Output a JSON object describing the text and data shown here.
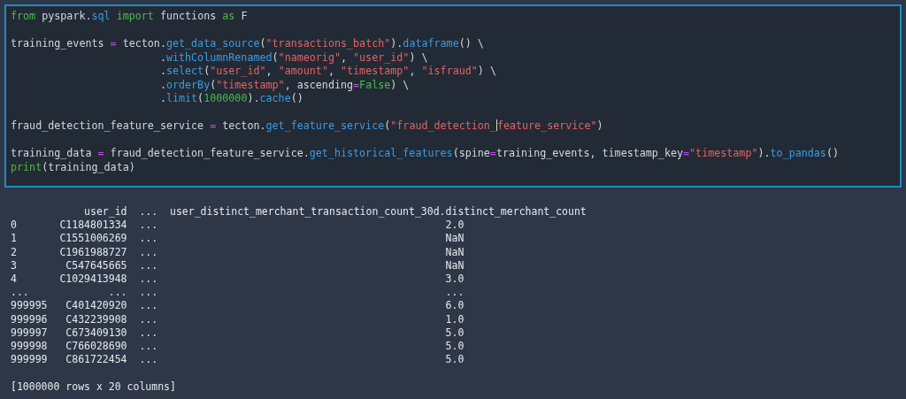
{
  "code_cell": {
    "lines": [
      {
        "kind": "code",
        "tokens": [
          {
            "kind": "kw",
            "t": "from"
          },
          {
            "kind": "p",
            "t": " pyspark."
          },
          {
            "kind": "f",
            "t": "sql"
          },
          {
            "kind": "kw",
            "t": " import"
          },
          {
            "kind": "p",
            "t": " functions "
          },
          {
            "kind": "kw",
            "t": "as"
          },
          {
            "kind": "p",
            "t": " F"
          }
        ]
      },
      {
        "kind": "blank"
      },
      {
        "kind": "code",
        "tokens": [
          {
            "kind": "p",
            "t": "training_events "
          },
          {
            "kind": "op",
            "t": "="
          },
          {
            "kind": "p",
            "t": " tecton."
          },
          {
            "kind": "f",
            "t": "get_data_source"
          },
          {
            "kind": "p",
            "t": "("
          },
          {
            "kind": "s",
            "t": "\"transactions_batch\""
          },
          {
            "kind": "p",
            "t": ")."
          },
          {
            "kind": "f",
            "t": "dataframe"
          },
          {
            "kind": "p",
            "t": "() \\"
          }
        ]
      },
      {
        "kind": "code",
        "tokens": [
          {
            "kind": "p",
            "t": "                        ."
          },
          {
            "kind": "f",
            "t": "withColumnRenamed"
          },
          {
            "kind": "p",
            "t": "("
          },
          {
            "kind": "s",
            "t": "\"nameorig\""
          },
          {
            "kind": "p",
            "t": ", "
          },
          {
            "kind": "s",
            "t": "\"user_id\""
          },
          {
            "kind": "p",
            "t": ") \\"
          }
        ]
      },
      {
        "kind": "code",
        "tokens": [
          {
            "kind": "p",
            "t": "                        ."
          },
          {
            "kind": "f",
            "t": "select"
          },
          {
            "kind": "p",
            "t": "("
          },
          {
            "kind": "s",
            "t": "\"user_id\""
          },
          {
            "kind": "p",
            "t": ", "
          },
          {
            "kind": "s",
            "t": "\"amount\""
          },
          {
            "kind": "p",
            "t": ", "
          },
          {
            "kind": "s",
            "t": "\"timestamp\""
          },
          {
            "kind": "p",
            "t": ", "
          },
          {
            "kind": "s",
            "t": "\"isfraud\""
          },
          {
            "kind": "p",
            "t": ") \\"
          }
        ]
      },
      {
        "kind": "code",
        "tokens": [
          {
            "kind": "p",
            "t": "                        ."
          },
          {
            "kind": "f",
            "t": "orderBy"
          },
          {
            "kind": "p",
            "t": "("
          },
          {
            "kind": "s",
            "t": "\"timestamp\""
          },
          {
            "kind": "p",
            "t": ", ascending"
          },
          {
            "kind": "op",
            "t": "="
          },
          {
            "kind": "kw",
            "t": "False"
          },
          {
            "kind": "p",
            "t": ") \\"
          }
        ]
      },
      {
        "kind": "code",
        "tokens": [
          {
            "kind": "p",
            "t": "                        ."
          },
          {
            "kind": "f",
            "t": "limit"
          },
          {
            "kind": "p",
            "t": "("
          },
          {
            "kind": "n",
            "t": "1000000"
          },
          {
            "kind": "p",
            "t": ")."
          },
          {
            "kind": "f",
            "t": "cache"
          },
          {
            "kind": "p",
            "t": "()"
          }
        ]
      },
      {
        "kind": "blank"
      },
      {
        "kind": "code",
        "tokens": [
          {
            "kind": "p",
            "t": "fraud_detection_feature_service "
          },
          {
            "kind": "op",
            "t": "="
          },
          {
            "kind": "p",
            "t": " tecton."
          },
          {
            "kind": "f",
            "t": "get_feature_service"
          },
          {
            "kind": "p",
            "t": "("
          },
          {
            "kind": "s",
            "t": "\"fraud_detection_",
            "cursor": true
          },
          {
            "kind": "s",
            "t": "feature_service\""
          },
          {
            "kind": "p",
            "t": ")"
          }
        ]
      },
      {
        "kind": "blank"
      },
      {
        "kind": "code",
        "tokens": [
          {
            "kind": "p",
            "t": "training_data "
          },
          {
            "kind": "op",
            "t": "="
          },
          {
            "kind": "p",
            "t": " fraud_detection_feature_service."
          },
          {
            "kind": "f",
            "t": "get_historical_features"
          },
          {
            "kind": "p",
            "t": "(spine"
          },
          {
            "kind": "op",
            "t": "="
          },
          {
            "kind": "p",
            "t": "training_events, timestamp_key"
          },
          {
            "kind": "op",
            "t": "="
          },
          {
            "kind": "s",
            "t": "\"timestamp\""
          },
          {
            "kind": "p",
            "t": ")."
          },
          {
            "kind": "f",
            "t": "to_pandas"
          },
          {
            "kind": "p",
            "t": "()"
          }
        ]
      },
      {
        "kind": "code",
        "tokens": [
          {
            "kind": "kw",
            "t": "print"
          },
          {
            "kind": "p",
            "t": "(training_data)"
          }
        ]
      }
    ]
  },
  "output": {
    "columns": [
      "user_id",
      "...",
      "user_distinct_merchant_transaction_count_30d.distinct_merchant_count"
    ],
    "rows": [
      {
        "index": "0",
        "cells": [
          "C1184801334",
          "...",
          "2.0"
        ]
      },
      {
        "index": "1",
        "cells": [
          "C1551006269",
          "...",
          "NaN"
        ]
      },
      {
        "index": "2",
        "cells": [
          "C1961988727",
          "...",
          "NaN"
        ]
      },
      {
        "index": "3",
        "cells": [
          "C547645665",
          "...",
          "NaN"
        ]
      },
      {
        "index": "4",
        "cells": [
          "C1029413948",
          "...",
          "3.0"
        ]
      },
      {
        "index": "...",
        "cells": [
          "...",
          "...",
          "..."
        ]
      },
      {
        "index": "999995",
        "cells": [
          "C401420920",
          "...",
          "6.0"
        ]
      },
      {
        "index": "999996",
        "cells": [
          "C432239908",
          "...",
          "1.0"
        ]
      },
      {
        "index": "999997",
        "cells": [
          "C673409130",
          "...",
          "5.0"
        ]
      },
      {
        "index": "999998",
        "cells": [
          "C766028690",
          "...",
          "5.0"
        ]
      },
      {
        "index": "999999",
        "cells": [
          "C861722454",
          "...",
          "5.0"
        ]
      }
    ],
    "summary": "[1000000 rows x 20 columns]"
  }
}
